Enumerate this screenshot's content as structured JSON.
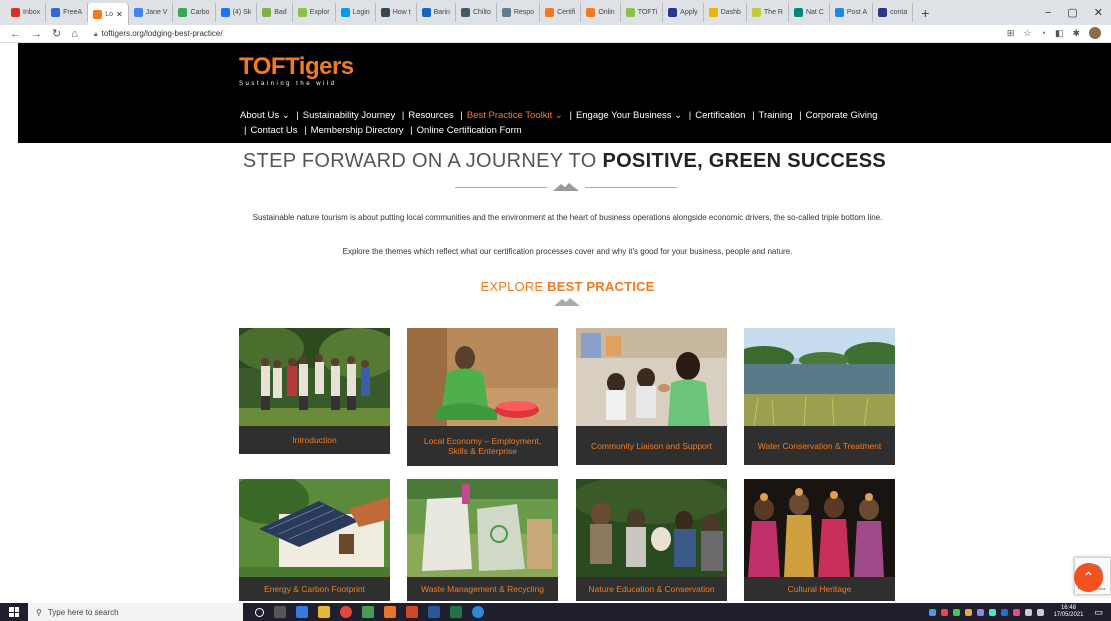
{
  "browser": {
    "tabs": [
      {
        "label": "Inbox",
        "color": "#d93025"
      },
      {
        "label": "FreeA",
        "color": "#3367d6"
      },
      {
        "label": "Lo",
        "color": "#f47a20",
        "active": true
      },
      {
        "label": "Jane V",
        "color": "#4285f4"
      },
      {
        "label": "Carbo",
        "color": "#34a853"
      },
      {
        "label": "(4) Sk",
        "color": "#1877f2"
      },
      {
        "label": "Bad",
        "color": "#7cb342"
      },
      {
        "label": "Explor",
        "color": "#8bc34a"
      },
      {
        "label": "Login",
        "color": "#039be5"
      },
      {
        "label": "How t",
        "color": "#37474f"
      },
      {
        "label": "Barin",
        "color": "#1565c0"
      },
      {
        "label": "Chilto",
        "color": "#455a64"
      },
      {
        "label": "Respo",
        "color": "#607d8b"
      },
      {
        "label": "Certifi",
        "color": "#f47a20"
      },
      {
        "label": "Onlin",
        "color": "#f47a20"
      },
      {
        "label": "TOFTi",
        "color": "#8bc34a"
      },
      {
        "label": "Apply",
        "color": "#283593"
      },
      {
        "label": "Dashb",
        "color": "#e6b800"
      },
      {
        "label": "The R",
        "color": "#c0ca33"
      },
      {
        "label": "Nat C",
        "color": "#00897b"
      },
      {
        "label": "Post A",
        "color": "#1e88e5"
      },
      {
        "label": "conta",
        "color": "#283593"
      }
    ],
    "new_tab": "+",
    "tab_close": "✕",
    "controls": {
      "minimize": "−",
      "maximize": "▢",
      "close": "✕"
    },
    "url": "toftigers.org/lodging-best-practice/"
  },
  "site": {
    "logo_text": "TOFTigers",
    "logo_tagline": "Sustaining the wild",
    "nav": [
      {
        "label": "About Us ⌄",
        "highlight": false
      },
      {
        "label": "Sustainability Journey",
        "highlight": false
      },
      {
        "label": "Resources",
        "highlight": false
      },
      {
        "label": "Best Practice Toolkit ⌄",
        "highlight": true
      },
      {
        "label": "Engage Your Business ⌄",
        "highlight": false
      },
      {
        "label": "Certification",
        "highlight": false
      },
      {
        "label": "Training",
        "highlight": false
      },
      {
        "label": "Corporate Giving",
        "highlight": false
      },
      {
        "label": "Contact Us",
        "highlight": false
      },
      {
        "label": "Membership Directory",
        "highlight": false
      },
      {
        "label": "Online Certification Form",
        "highlight": false
      }
    ]
  },
  "main": {
    "hero_light": "STEP FORWARD ON A JOURNEY TO ",
    "hero_bold": "POSITIVE, GREEN SUCCESS",
    "intro": "Sustainable nature tourism is about putting local communities and the environment at the heart of business operations alongside economic drivers, the so-called triple bottom line.",
    "intro2": "Explore the themes which reflect what our certification processes cover and why it's good for your business, people and nature.",
    "explore_light": "EXPLORE ",
    "explore_bold": "BEST PRACTICE",
    "cards": [
      {
        "label": "Introduction"
      },
      {
        "label": "Local Economy – Employment, Skills & Enterprise"
      },
      {
        "label": "Community Liaison and Support"
      },
      {
        "label": "Water Conservation & Treatment"
      },
      {
        "label": "Energy & Carbon Footprint"
      },
      {
        "label": "Waste Management & Recycling"
      },
      {
        "label": "Nature Education & Conservation"
      },
      {
        "label": "Cultural Heritage"
      }
    ]
  },
  "widgets": {
    "to_top": "⌃",
    "recaptcha_text": "Privacy - Terms"
  },
  "taskbar": {
    "search_placeholder": "Type here to search",
    "time": "16:48",
    "date": "17/05/2021"
  }
}
